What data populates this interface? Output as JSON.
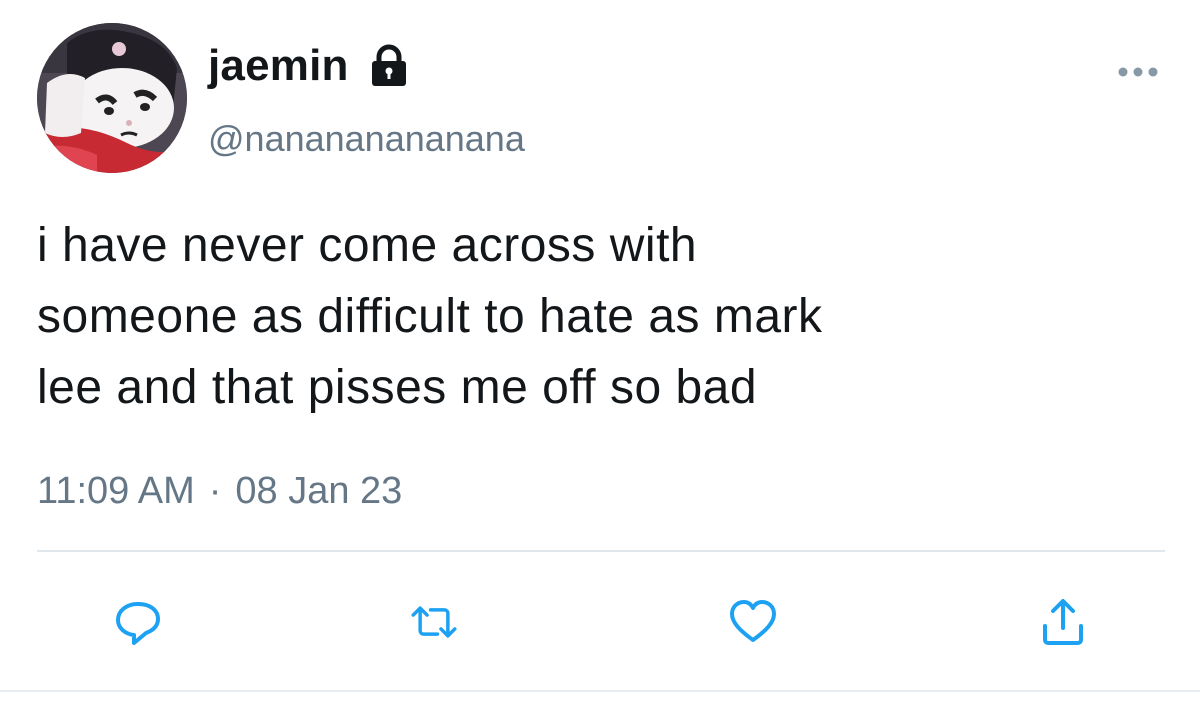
{
  "user": {
    "display_name": "jaemin",
    "handle": "@nanananananana",
    "protected": true,
    "avatar": "kuromi-character-avatar"
  },
  "tweet": {
    "text": "i have never come across with\nsomeone as difficult to hate as mark\nlee and that pisses me off so bad",
    "time": "11:09 AM",
    "separator": "·",
    "date": "08 Jan 23"
  },
  "actions": [
    {
      "name": "reply",
      "icon": "reply-icon"
    },
    {
      "name": "retweet",
      "icon": "retweet-icon"
    },
    {
      "name": "like",
      "icon": "heart-icon"
    },
    {
      "name": "share",
      "icon": "share-icon"
    }
  ],
  "colors": {
    "text_primary": "#14171a",
    "text_secondary": "#657786",
    "icon": "#1da1f2",
    "divider": "#e1e8ed"
  }
}
